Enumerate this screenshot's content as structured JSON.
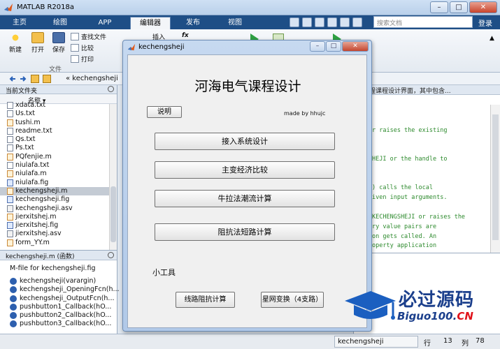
{
  "window": {
    "title": "MATLAB R2018a",
    "min": "–",
    "max": "□",
    "close": "✕"
  },
  "tabs": [
    {
      "label": "主页"
    },
    {
      "label": "绘图"
    },
    {
      "label": "APP"
    },
    {
      "label": "编辑器"
    },
    {
      "label": "发布"
    },
    {
      "label": "视图"
    }
  ],
  "search": {
    "placeholder": "搜索文档"
  },
  "login": "登录",
  "ribbon": {
    "new": "新建",
    "open": "打开",
    "save": "保存",
    "find_files": "查找文件",
    "compare": "比较",
    "print": "打印",
    "insert": "插入",
    "fx": "fx",
    "file_group": "文件"
  },
  "address": {
    "path": "« kechengsheji"
  },
  "current_folder": {
    "header": "当前文件夹",
    "col_name": "名称",
    "files": [
      {
        "name": "xdata.txt",
        "kind": "txt"
      },
      {
        "name": "Us.txt",
        "kind": "txt"
      },
      {
        "name": "tushi.m",
        "kind": "m"
      },
      {
        "name": "readme.txt",
        "kind": "txt"
      },
      {
        "name": "Qs.txt",
        "kind": "txt"
      },
      {
        "name": "Ps.txt",
        "kind": "txt"
      },
      {
        "name": "PQfenjie.m",
        "kind": "m"
      },
      {
        "name": "niulafa.txt",
        "kind": "txt"
      },
      {
        "name": "niulafa.m",
        "kind": "m"
      },
      {
        "name": "niulafa.fig",
        "kind": "fig"
      },
      {
        "name": "kechengsheji.m",
        "kind": "m",
        "selected": true
      },
      {
        "name": "kechengsheji.fig",
        "kind": "fig"
      },
      {
        "name": "kechengsheji.asv",
        "kind": "asv"
      },
      {
        "name": "jierxitshej.m",
        "kind": "m"
      },
      {
        "name": "jierxitshej.fig",
        "kind": "fig"
      },
      {
        "name": "jierxitshej.asv",
        "kind": "asv"
      },
      {
        "name": "form_YY.m",
        "kind": "m"
      }
    ]
  },
  "details": {
    "header": "kechengsheji.m  (函数)",
    "description": "M-file for kechengsheji.fig",
    "functions": [
      "kechengsheji(varargin)",
      "kechengsheji_OpeningFcn(h...",
      "kechengsheji_OutputFcn(h...",
      "pushbutton1_Callback(hO...",
      "pushbutton2_Callback(hO...",
      "pushbutton3_Callback(hO..."
    ]
  },
  "editor": {
    "header": "气工程课程设计界面，其中包含...",
    "lines": [
      "r raises the existing",
      "HEJI or the handle to",
      ") calls the local",
      "iven input arguments.",
      "KECHENGSHEJI or raises the",
      "ry value pairs are",
      "on gets called.  An",
      "operty application"
    ]
  },
  "dialog": {
    "title": "kechengsheji",
    "heading": "河海电气课程设计",
    "explain_btn": "说明",
    "made_by": "made by hhujc",
    "buttons": [
      "接入系统设计",
      "主变经济比较",
      "牛拉法潮流计算",
      "阻抗法短路计算"
    ],
    "tools_label": "小工具",
    "tool_buttons": [
      "线路阻抗计算",
      "星网变换（4支路）"
    ]
  },
  "status": {
    "file": "kechengsheji",
    "row_label": "行",
    "row": "13",
    "col_label": "列",
    "col": "78"
  },
  "watermark": {
    "brand": "必过源码",
    "url_main": "Biguo100.",
    "url_cn": "CN"
  },
  "colors": {
    "ribbon_blue": "#1e4e86",
    "accent": "#1b3f8c",
    "watermark_red": "#e0131b"
  }
}
